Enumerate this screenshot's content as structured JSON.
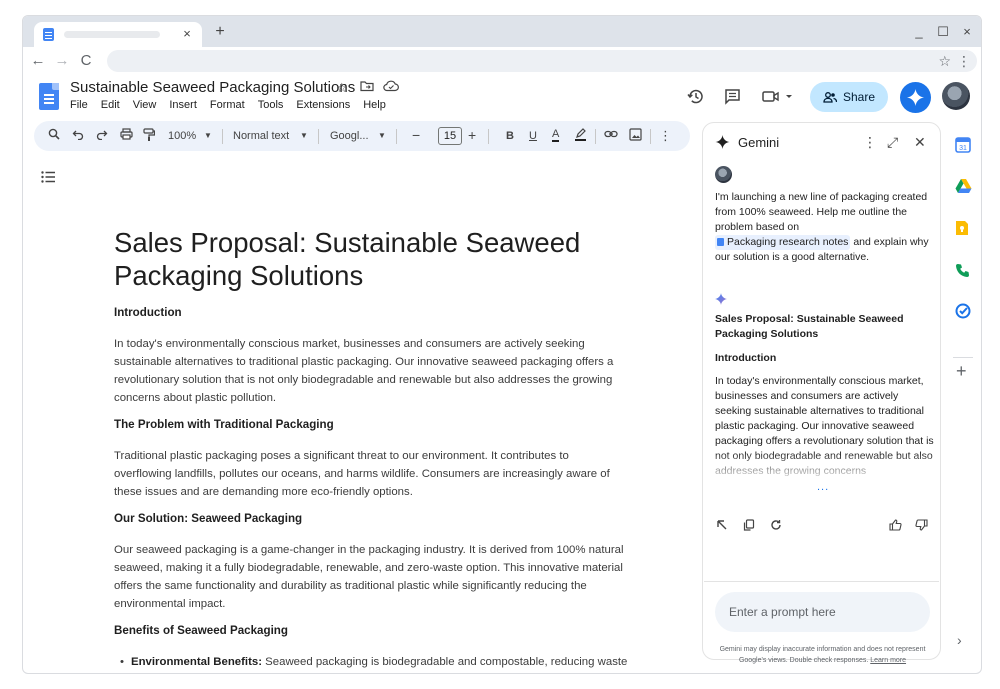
{
  "browser": {
    "tab_close": "×",
    "new_tab": "+",
    "minimize": "_",
    "maximize": "☐",
    "close": "×",
    "back": "←",
    "forward": "→",
    "reload": "C",
    "bookmark_star": "☆",
    "menu": "⋮"
  },
  "docs": {
    "title": "Sustainable Seaweed Packaging Solutions",
    "menu": [
      "File",
      "Edit",
      "View",
      "Insert",
      "Format",
      "Tools",
      "Extensions",
      "Help"
    ],
    "share_label": "Share"
  },
  "toolbar": {
    "zoom": "100%",
    "style": "Normal text",
    "font": "Googl...",
    "font_size": "15",
    "minus": "−",
    "plus": "+",
    "bold": "B",
    "underline": "U",
    "text_color": "A",
    "more": "⋮"
  },
  "document": {
    "heading": "Sales Proposal: Sustainable Seaweed Packaging Solutions",
    "sections": [
      {
        "title": "Introduction",
        "body": "In today's environmentally conscious market, businesses and consumers are actively seeking sustainable alternatives to traditional plastic packaging. Our innovative seaweed packaging offers a revolutionary solution that is not only biodegradable and renewable but also addresses the growing concerns about plastic pollution."
      },
      {
        "title": "The Problem with Traditional Packaging",
        "body": "Traditional plastic packaging poses a significant threat to our environment. It contributes to overflowing landfills, pollutes our oceans, and harms wildlife. Consumers are increasingly aware of these issues and are demanding more eco-friendly options."
      },
      {
        "title": "Our Solution: Seaweed Packaging",
        "body": "Our seaweed packaging is a game-changer in the packaging industry. It is derived from 100% natural seaweed, making it a fully biodegradable, renewable, and zero-waste option. This innovative material offers the same functionality and durability as traditional plastic while significantly reducing the environmental impact."
      },
      {
        "title": "Benefits of Seaweed Packaging",
        "body": ""
      }
    ],
    "bullet_label": "Environmental Benefits:",
    "bullet_text": " Seaweed packaging is biodegradable and compostable, reducing waste"
  },
  "gemini": {
    "title": "Gemini",
    "more": "⋮",
    "expand": "⤢",
    "close": "✕",
    "prompt_before": "I'm launching a new line of packaging created from 100% seaweed. Help me outline the problem based on",
    "prompt_chip": "Packaging research notes",
    "prompt_after": "and explain why our solution is a good alternative.",
    "response_title": "Sales Proposal: Sustainable Seaweed Packaging Solutions",
    "response_heading": "Introduction",
    "response_body": "In today's environmentally conscious market, businesses and consumers are actively seeking sustainable alternatives to traditional plastic packaging. Our innovative seaweed packaging offers a revolutionary solution that is not only biodegradable and renewable but also addresses the growing concerns",
    "more_dots": "...",
    "input_placeholder": "Enter a prompt here",
    "disclaimer": "Gemini may display inaccurate information and does not represent Google's views. Double check responses.",
    "learn_more": "Learn more"
  },
  "side": {
    "add": "+",
    "expand": "›"
  }
}
